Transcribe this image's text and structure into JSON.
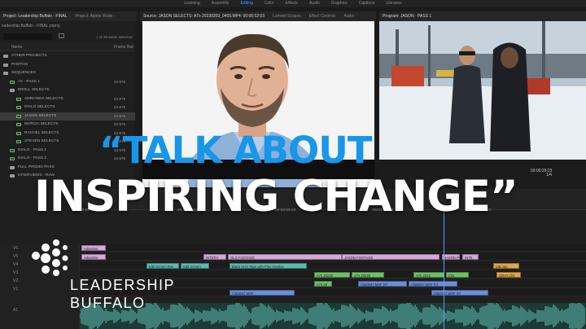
{
  "workspaces": [
    "Learning",
    "Assembly",
    "Editing",
    "Color",
    "Effects",
    "Audio",
    "Graphics",
    "Captions",
    "Libraries"
  ],
  "active_workspace": "Editing",
  "project_tabs": [
    "Project: Leadership Buffalo - FINAL",
    "Project: Alpine Made -"
  ],
  "source_tabs": [
    "Source: JASON SELECTS: A7s 20230203_0405.MP4: 00:06:52:03",
    "Lumetri Scopes",
    "Effect Controls",
    "Audio"
  ],
  "program_tab": "Program: JASON - PASS 1",
  "project": {
    "file": "eadership Buffalo - FINAL.prproj",
    "count": "1 of 29 items selected",
    "col_name": "Name",
    "col_rate": "Frame Rat",
    "rows": [
      {
        "name": "OTHER PROJECTS",
        "type": "folder",
        "indent": 0,
        "rate": ""
      },
      {
        "name": "PHOTOS",
        "type": "folder",
        "indent": 0,
        "rate": ""
      },
      {
        "name": "SEQUENCES",
        "type": "folder",
        "indent": 0,
        "rate": ""
      },
      {
        "name": "AV - PASS 1",
        "type": "seq",
        "indent": 1,
        "rate": "23.976"
      },
      {
        "name": "BROLL SELECTS",
        "type": "folder",
        "indent": 1,
        "rate": ""
      },
      {
        "name": "ADRIANNA SELECTS",
        "type": "seq",
        "indent": 2,
        "rate": "23.976"
      },
      {
        "name": "DIALO SELECTS",
        "type": "seq",
        "indent": 2,
        "rate": "23.976"
      },
      {
        "name": "JASON SELECTS",
        "type": "seq",
        "indent": 2,
        "rate": "23.976",
        "selected": true
      },
      {
        "name": "MARCIA SELECTS",
        "type": "seq",
        "indent": 2,
        "rate": "23.976"
      },
      {
        "name": "RACHEL SELECTS",
        "type": "seq",
        "indent": 2,
        "rate": "23.976"
      },
      {
        "name": "STEVEN SELECTS",
        "type": "seq",
        "indent": 2,
        "rate": "23.976"
      },
      {
        "name": "DIALO - PASS 1",
        "type": "seq",
        "indent": 1,
        "rate": "23.976"
      },
      {
        "name": "DIALO - PASS 2",
        "type": "seq",
        "indent": 1,
        "rate": "23.976"
      },
      {
        "name": "FULL PROMO PASS",
        "type": "folder",
        "indent": 1,
        "rate": ""
      },
      {
        "name": "INTERVIEWS - RAW",
        "type": "folder",
        "indent": 1,
        "rate": ""
      }
    ]
  },
  "program": {
    "timecode": "00:00:29:23",
    "fit": "1/4"
  },
  "timeline": {
    "ruler_timecodes": [
      "00:00:29:23",
      "00:00:44:23",
      "00:00:59:23",
      "00:01:14:23",
      "00:01:29:23"
    ],
    "track_labels": [
      "V6",
      "V5",
      "V4",
      "V3",
      "V2",
      "V1",
      "A1"
    ],
    "clips": [
      {
        "label": "Adjustme",
        "color": "pink",
        "track": 0
      },
      {
        "label": "INTERV",
        "color": "pink",
        "track": 1
      },
      {
        "label": "OLD FOOTAGE",
        "color": "pink",
        "track": 1
      },
      {
        "label": "JASON FOOTAGE",
        "color": "pink",
        "track": 1
      },
      {
        "label": "JASON PO",
        "color": "pink",
        "track": 1
      },
      {
        "label": "INTE",
        "color": "pink",
        "track": 1
      },
      {
        "label": "Adjustme",
        "color": "pink",
        "track": 1
      },
      {
        "label": "Black VHS Tape with Play Overlay",
        "color": "teal",
        "track": 2
      },
      {
        "label": "Edit Screen Rec",
        "color": "teal",
        "track": 2
      },
      {
        "label": "Edit Screen",
        "color": "teal",
        "track": 2
      },
      {
        "label": "A7s 20230",
        "color": "green",
        "track": 3
      },
      {
        "label": "A7s 20230",
        "color": "green",
        "track": 3
      },
      {
        "label": "A7s 2023",
        "color": "green",
        "track": 3
      },
      {
        "label": "Clip",
        "color": "green",
        "track": 3
      },
      {
        "label": "LBLogo",
        "color": "orange",
        "track": 2
      },
      {
        "label": "A7s 20",
        "color": "green",
        "track": 4
      },
      {
        "label": "Clip0047.MXF [V]",
        "color": "blue",
        "track": 4
      },
      {
        "label": "Clip0047.MXF [V]",
        "color": "blue",
        "track": 4
      },
      {
        "label": "Clip0047.MXF",
        "color": "blue",
        "track": 5
      },
      {
        "label": "Clip0047.MXF [V]",
        "color": "blue",
        "track": 5
      },
      {
        "label": "GBVA Clip",
        "color": "orange",
        "track": 3
      }
    ]
  },
  "overlay": {
    "line1": "“TALK ABOUT",
    "line2": "INSPIRING CHANGE”",
    "line1_color": "#1796ea",
    "line2_color": "#ffffff"
  },
  "logo": {
    "line1": "LEADERSHIP",
    "line2": "BUFFALO",
    "icon": "dot-cluster-icon"
  }
}
